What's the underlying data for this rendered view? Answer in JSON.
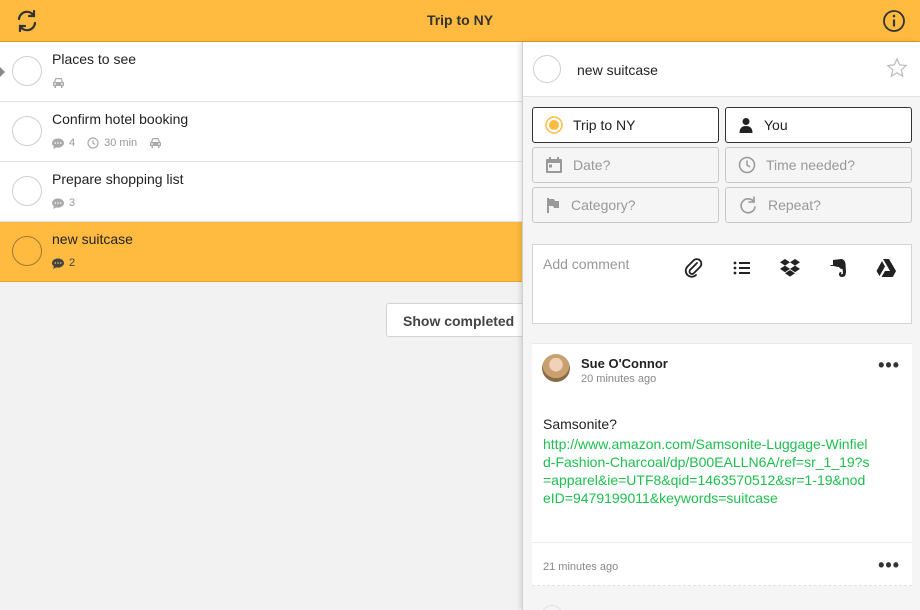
{
  "header": {
    "title": "Trip to NY",
    "sync_icon": "sync-icon",
    "info_icon": "info-icon"
  },
  "tasks": [
    {
      "name": "Places to see",
      "comments": "",
      "duration": "",
      "has_car": true,
      "selected": false
    },
    {
      "name": "Confirm hotel booking",
      "comments": "4",
      "duration": "30 min",
      "has_car": true,
      "selected": false
    },
    {
      "name": "Prepare shopping list",
      "comments": "3",
      "duration": "",
      "has_car": false,
      "selected": false
    },
    {
      "name": "new suitcase",
      "comments": "2",
      "duration": "",
      "has_car": false,
      "selected": true
    }
  ],
  "show_completed_label": "Show completed",
  "detail": {
    "task_name": "new suitcase",
    "fields": {
      "list": "Trip to NY",
      "assignee": "You",
      "date": "Date?",
      "time_needed": "Time needed?",
      "category": "Category?",
      "repeat": "Repeat?"
    },
    "comment_placeholder": "Add comment",
    "comments": [
      {
        "author": "Sue O'Connor",
        "time": "20 minutes ago",
        "text": "Samsonite?",
        "link": "http://www.amazon.com/Samsonite-Luggage-Winfield-Fashion-Charcoal/dp/B00EALLN6A/ref=sr_1_19?s=apparel&ie=UTF8&qid=1463570512&sr=1-19&nodeID=9479199011&keywords=suitcase"
      },
      {
        "time": "21 minutes ago"
      }
    ]
  },
  "colors": {
    "accent": "#ffbb3f",
    "link": "#1fbf4f"
  }
}
